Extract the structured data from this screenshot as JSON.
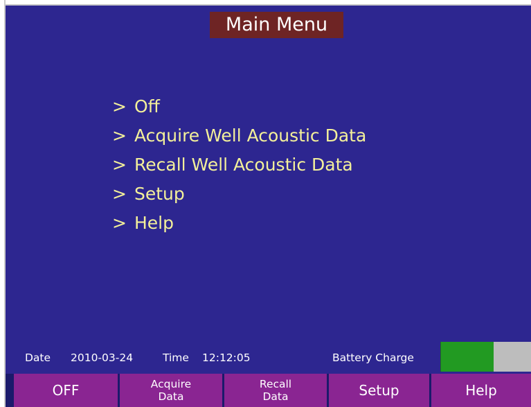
{
  "title": "Main Menu",
  "menu": {
    "arrow": ">",
    "items": [
      {
        "label": "Off"
      },
      {
        "label": "Acquire Well Acoustic Data"
      },
      {
        "label": "Recall Well Acoustic Data"
      },
      {
        "label": "Setup"
      },
      {
        "label": "Help"
      }
    ]
  },
  "status": {
    "date_label": "Date",
    "date": "2010-03-24",
    "time_label": "Time",
    "time": "12:12:05",
    "battery_label": "Battery Charge",
    "battery_level": 0.58
  },
  "softkeys": [
    {
      "label": "OFF"
    },
    {
      "label": "Acquire\nData"
    },
    {
      "label": "Recall\nData"
    },
    {
      "label": "Setup"
    },
    {
      "label": "Help"
    }
  ],
  "colors": {
    "screen_background": "#2d2690",
    "title_background": "#6e2424",
    "menu_text": "#f3f09a",
    "softkey_background": "#8a2592",
    "battery_fill": "#229a22",
    "battery_empty": "#bdbdbd"
  }
}
